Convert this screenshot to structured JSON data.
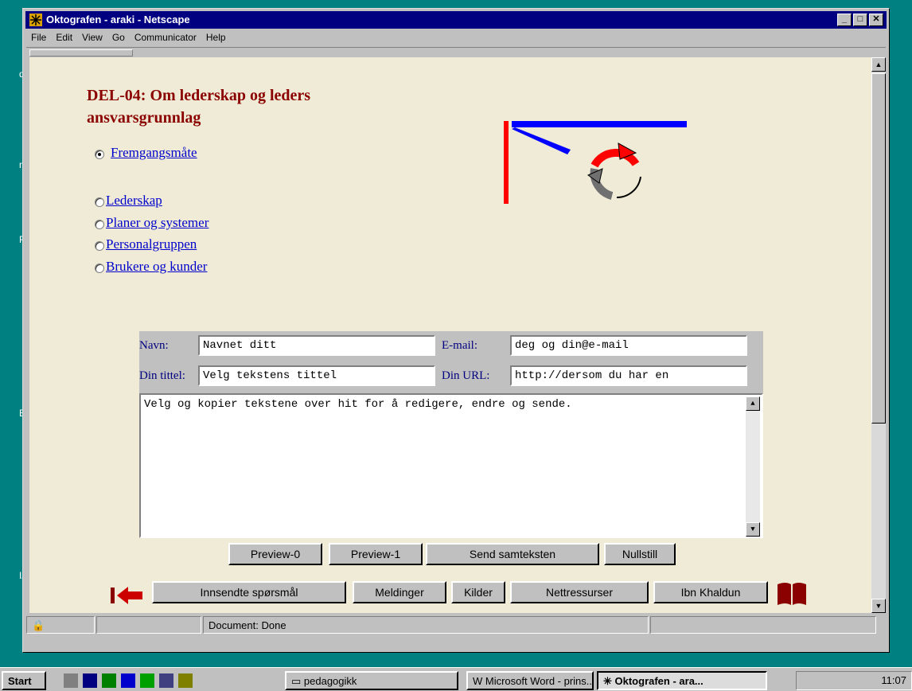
{
  "window": {
    "title": "Oktografen - araki - Netscape"
  },
  "menu": [
    "File",
    "Edit",
    "View",
    "Go",
    "Communicator",
    "Help"
  ],
  "desktop_labels": [
    "d",
    "n",
    "F",
    "E",
    "IA"
  ],
  "page": {
    "title_line1": "DEL-04: Om lederskap og leders",
    "title_line2": "ansvarsgrunnlag",
    "links": [
      {
        "label": "Fremgangsmåte",
        "checked": true
      },
      {
        "label": "Lederskap",
        "checked": false
      },
      {
        "label": "Planer og systemer",
        "checked": false
      },
      {
        "label": "Personalgruppen",
        "checked": false
      },
      {
        "label": "Brukere og kunder",
        "checked": false
      }
    ]
  },
  "form": {
    "name_label": "Navn:",
    "name_value": "Navnet ditt",
    "email_label": "E-mail:",
    "email_value": "deg og din@e-mail",
    "title_label": "Din tittel:",
    "title_value": "Velg tekstens tittel",
    "url_label": "Din URL:",
    "url_value": "http://dersom du har en",
    "textarea": "Velg og kopier tekstene over hit for å redigere, endre og sende."
  },
  "form_buttons": [
    "Preview-0",
    "Preview-1",
    "Send samteksten",
    "Nullstill"
  ],
  "nav_buttons": [
    "Innsendte spørsmål",
    "Meldinger",
    "Kilder",
    "Nettressurser",
    "Ibn Khaldun"
  ],
  "status": "Document: Done",
  "taskbar": {
    "start": "Start",
    "tasks": [
      "pedagogikk",
      "Microsoft Word - prins...",
      "Oktografen - ara..."
    ],
    "clock": "11:07"
  },
  "colors": {
    "title_red": "#8b0000",
    "link_blue": "#0000cc",
    "content_bg": "#efebd6",
    "titlebar": "#000080"
  }
}
